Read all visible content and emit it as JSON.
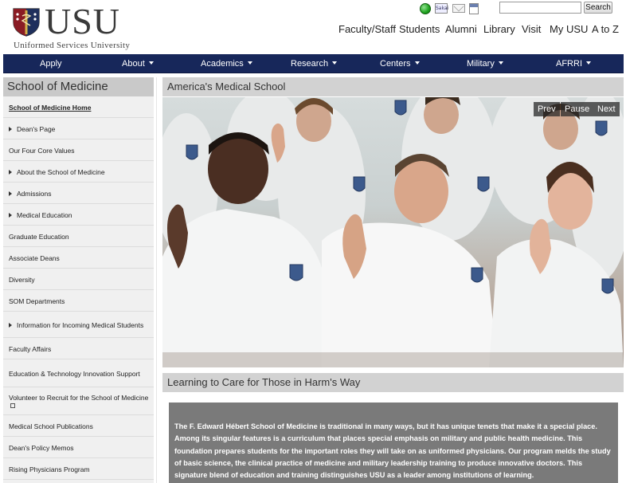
{
  "header": {
    "logo_text": "USU",
    "logo_sub": "Uniformed Services University",
    "sakai_label": "Sakai",
    "search": {
      "placeholder": "",
      "button": "Search"
    },
    "top_links": [
      "Faculty/Staff",
      "Students",
      "Alumni",
      "Library",
      "Visit",
      "My USU",
      "A to Z"
    ]
  },
  "nav": {
    "items": [
      {
        "label": "Apply",
        "dropdown": false
      },
      {
        "label": "About",
        "dropdown": true
      },
      {
        "label": "Academics",
        "dropdown": true
      },
      {
        "label": "Research",
        "dropdown": true
      },
      {
        "label": "Centers",
        "dropdown": true
      },
      {
        "label": "Military",
        "dropdown": true
      },
      {
        "label": "AFRRI",
        "dropdown": true
      }
    ]
  },
  "sidebar": {
    "title": "School of Medicine",
    "items": [
      {
        "label": "School of Medicine Home",
        "active": true,
        "expandable": false
      },
      {
        "label": "Dean's Page",
        "expandable": true
      },
      {
        "label": "Our Four Core Values",
        "expandable": false
      },
      {
        "label": "About the School of Medicine",
        "expandable": true
      },
      {
        "label": "Admissions",
        "expandable": true
      },
      {
        "label": "Medical Education",
        "expandable": true
      },
      {
        "label": "Graduate Education",
        "expandable": false
      },
      {
        "label": "Associate Deans",
        "expandable": false
      },
      {
        "label": "Diversity",
        "expandable": false
      },
      {
        "label": "SOM Departments",
        "expandable": false
      },
      {
        "label": "Information for Incoming Medical Students",
        "expandable": true
      },
      {
        "label": "Faculty Affairs",
        "expandable": false
      },
      {
        "label": "Education & Technology Innovation Support",
        "expandable": false
      },
      {
        "label": "Volunteer to Recruit for the School of Medicine",
        "expandable": false,
        "external": true
      },
      {
        "label": "Medical School Publications",
        "expandable": false
      },
      {
        "label": "Dean's Policy Memos",
        "expandable": false
      },
      {
        "label": "Rising Physicians Program",
        "expandable": false
      }
    ]
  },
  "main": {
    "title": "America's Medical School",
    "slider": {
      "prev": "Prev",
      "pause": "Pause",
      "next": "Next"
    },
    "caption": "Learning to Care for Those in Harm's Way",
    "intro": "The F. Edward Hébert School of Medicine is traditional in many ways, but it has unique tenets that make it a special place. Among its singular features is a curriculum that places special emphasis on military and public health medicine. This foundation prepares students for the important roles they will take on as uniformed physicians. Our program melds the study of basic science, the clinical practice of medicine and military leadership training to produce innovative doctors. This signature blend of education and training distinguishes USU as a leader among institutions of learning."
  },
  "colors": {
    "nav_bg": "#17275a",
    "sidebar_bg": "#f0f0f0",
    "panel_header_bg": "#d2d2d2",
    "intro_bg": "#7a7a7a"
  }
}
